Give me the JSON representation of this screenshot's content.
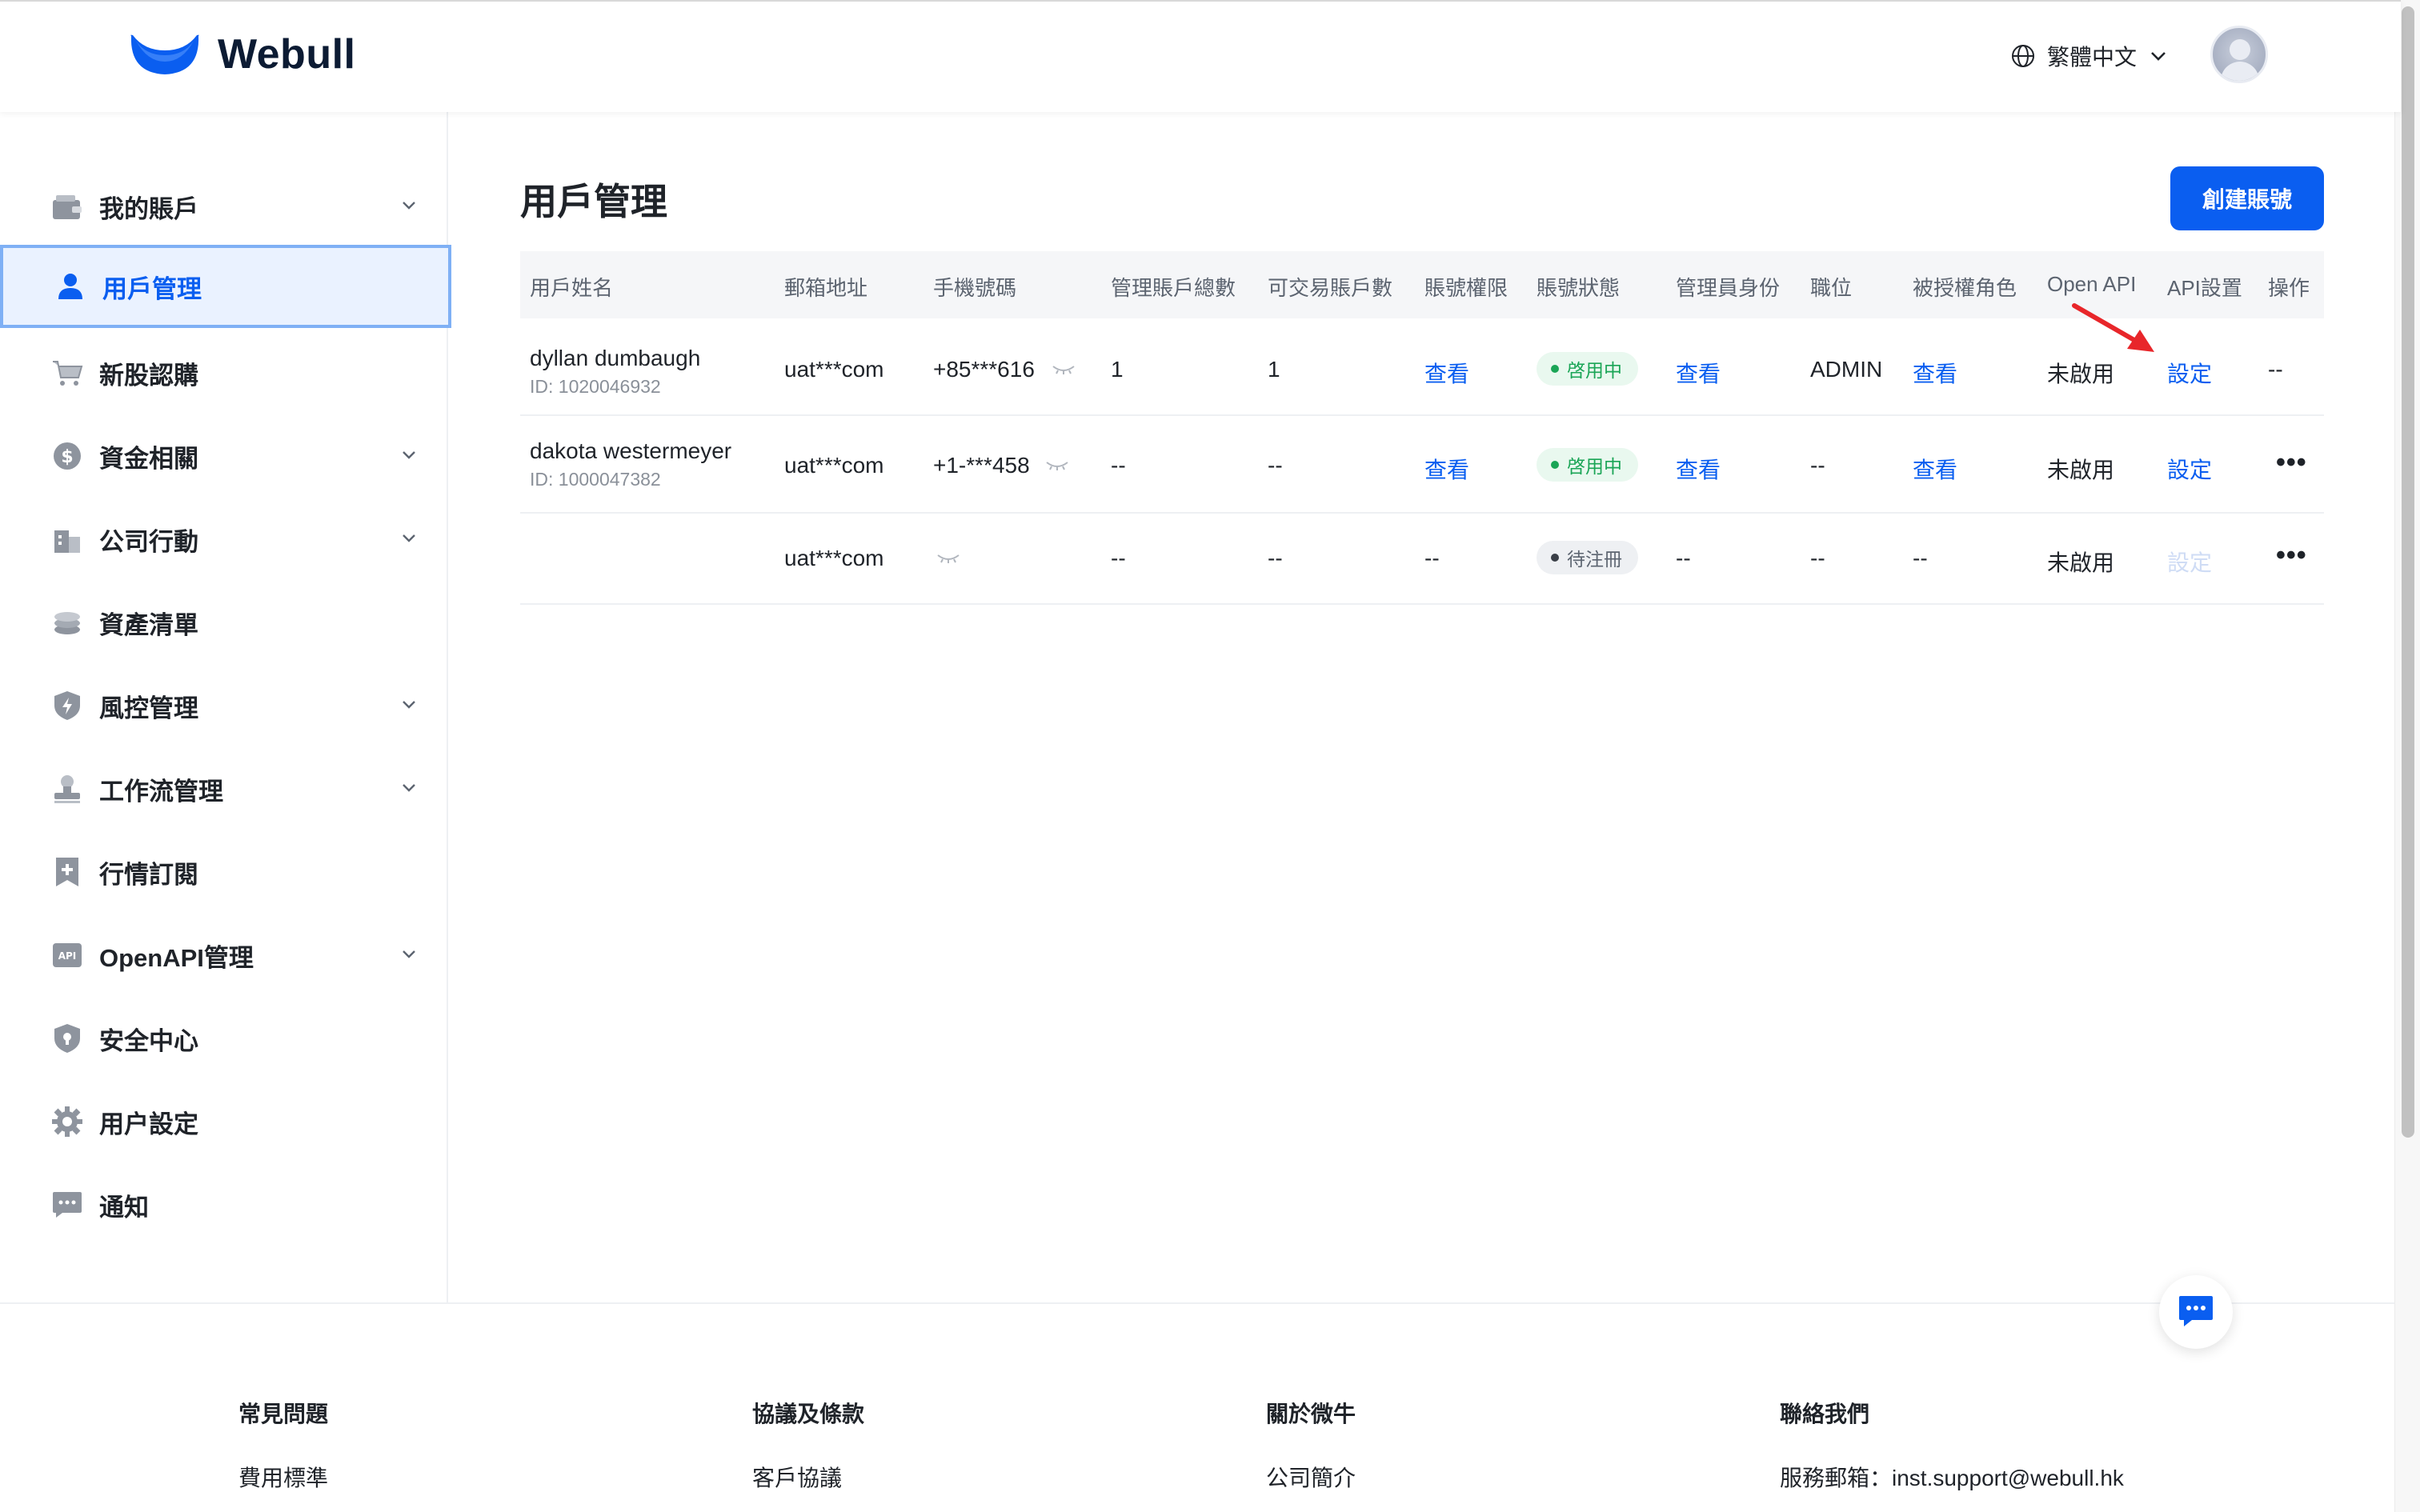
{
  "header": {
    "logo_text": "Webull",
    "language": "繁體中文",
    "brand_color": "#0a5ef0"
  },
  "sidebar": {
    "items": [
      {
        "label": "我的賬戶",
        "icon": "wallet-icon",
        "expandable": true
      },
      {
        "label": "用戶管理",
        "icon": "user-icon",
        "expandable": false,
        "active": true
      },
      {
        "label": "新股認購",
        "icon": "cart-icon",
        "expandable": false
      },
      {
        "label": "資金相關",
        "icon": "dollar-icon",
        "expandable": true
      },
      {
        "label": "公司行動",
        "icon": "building-icon",
        "expandable": true
      },
      {
        "label": "資產清單",
        "icon": "coins-icon",
        "expandable": false
      },
      {
        "label": "風控管理",
        "icon": "shield-bolt-icon",
        "expandable": true
      },
      {
        "label": "工作流管理",
        "icon": "stamp-icon",
        "expandable": true
      },
      {
        "label": "行情訂閱",
        "icon": "bookmark-plus-icon",
        "expandable": false
      },
      {
        "label": "OpenAPI管理",
        "icon": "api-icon",
        "expandable": true
      },
      {
        "label": "安全中心",
        "icon": "shield-lock-icon",
        "expandable": false
      },
      {
        "label": "用户設定",
        "icon": "gear-icon",
        "expandable": false
      },
      {
        "label": "通知",
        "icon": "message-icon",
        "expandable": false
      }
    ]
  },
  "main": {
    "title": "用戶管理",
    "create_button": "創建賬號",
    "columns": [
      "用戶姓名",
      "郵箱地址",
      "手機號碼",
      "管理賬戶總數",
      "可交易賬戶數",
      "賬號權限",
      "賬號狀態",
      "管理員身份",
      "職位",
      "被授權角色",
      "Open API",
      "API設置",
      "操作"
    ],
    "rows": [
      {
        "name": "dyllan dumbaugh",
        "id": "ID: 1020046932",
        "email": "uat***com",
        "phone": "+85***616",
        "total_accounts": "1",
        "tradable_accounts": "1",
        "permission": "查看",
        "status": "啓用中",
        "admin": "查看",
        "position": "ADMIN",
        "role": "查看",
        "open_api": "未啟用",
        "api_setting": "設定",
        "action": "--"
      },
      {
        "name": "dakota westermeyer",
        "id": "ID: 1000047382",
        "email": "uat***com",
        "phone": "+1-***458",
        "total_accounts": "--",
        "tradable_accounts": "--",
        "permission": "查看",
        "status": "啓用中",
        "admin": "查看",
        "position": "--",
        "role": "查看",
        "open_api": "未啟用",
        "api_setting": "設定",
        "action": "•••"
      },
      {
        "name": "",
        "id": "",
        "email": "uat***com",
        "phone": "",
        "total_accounts": "--",
        "tradable_accounts": "--",
        "permission": "--",
        "status": "待注冊",
        "admin": "--",
        "position": "--",
        "role": "--",
        "open_api": "未啟用",
        "api_setting": "設定",
        "action": "•••"
      }
    ]
  },
  "footer": {
    "columns": [
      {
        "title": "常見問題",
        "link": "費用標準"
      },
      {
        "title": "協議及條款",
        "link": "客戶協議"
      },
      {
        "title": "關於微牛",
        "link": "公司簡介"
      },
      {
        "title": "聯絡我們",
        "link": "服務郵箱：inst.support@webull.hk"
      }
    ]
  }
}
